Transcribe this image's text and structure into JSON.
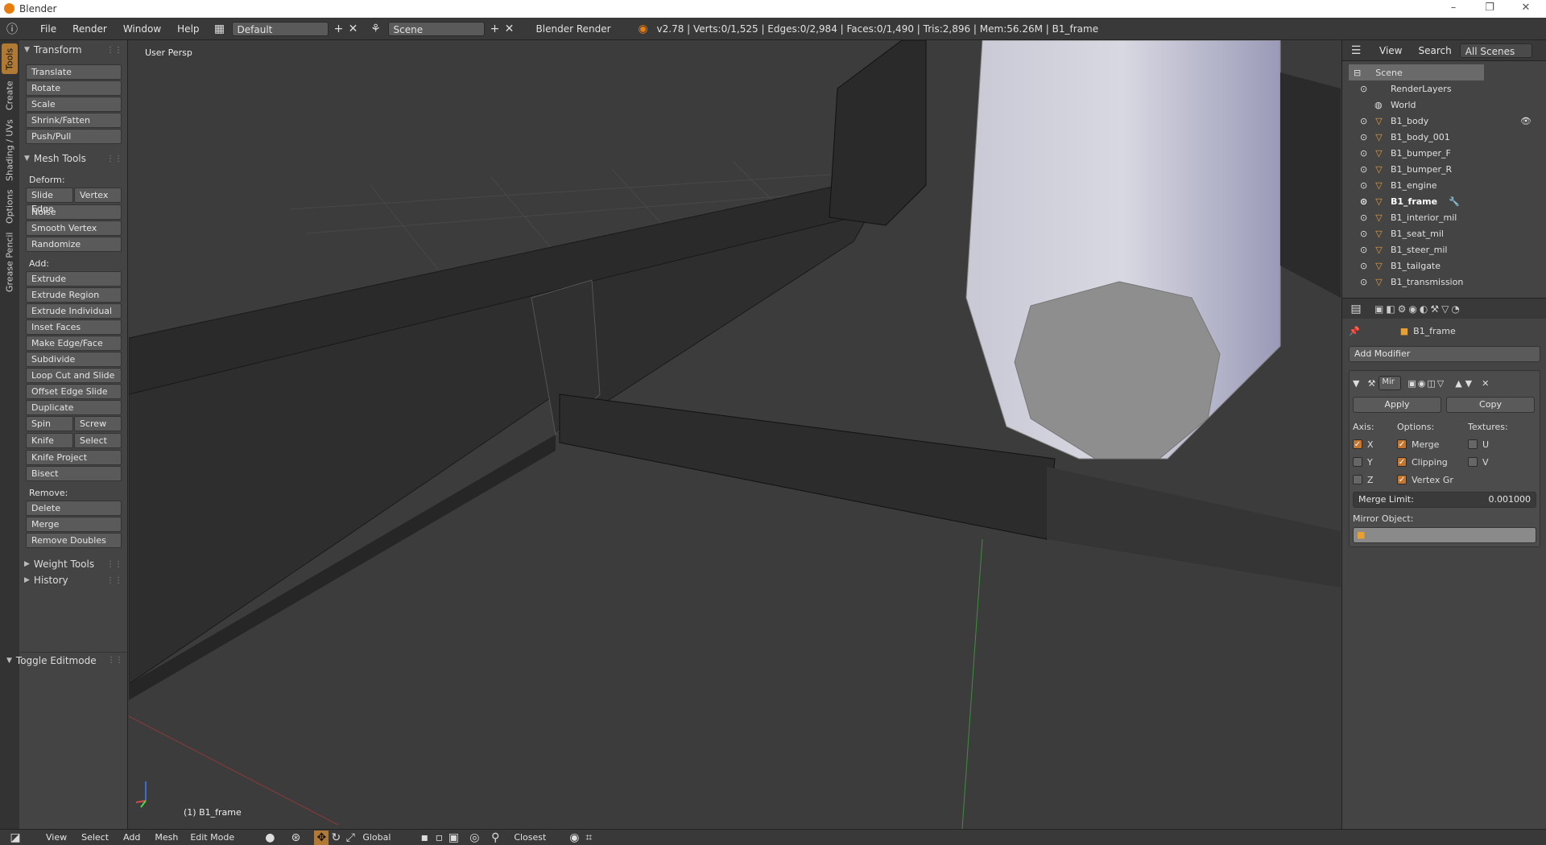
{
  "window": {
    "title": "Blender"
  },
  "infobar": {
    "menus": [
      "File",
      "Render",
      "Window",
      "Help"
    ],
    "layout": "Default",
    "scene": "Scene",
    "engine": "Blender Render",
    "stats": "v2.78 | Verts:0/1,525 | Edges:0/2,984 | Faces:0/1,490 | Tris:2,896 | Mem:56.26M | B1_frame"
  },
  "lefttabs": [
    "Tools",
    "Create",
    "Shading / UVs",
    "Options",
    "Grease Pencil"
  ],
  "toolshelf": {
    "transform": {
      "title": "Transform",
      "buttons": [
        "Translate",
        "Rotate",
        "Scale",
        "Shrink/Fatten",
        "Push/Pull"
      ]
    },
    "meshtools": {
      "title": "Mesh Tools",
      "deform_label": "Deform:",
      "slide_edge": "Slide Edge",
      "vertex": "Vertex",
      "noise": "Noise",
      "smooth_vertex": "Smooth Vertex",
      "randomize": "Randomize",
      "add_label": "Add:",
      "extrude": "Extrude",
      "extrude_region": "Extrude Region",
      "extrude_individual": "Extrude Individual",
      "inset_faces": "Inset Faces",
      "make_edge_face": "Make Edge/Face",
      "subdivide": "Subdivide",
      "loop_cut": "Loop Cut and Slide",
      "offset_edge": "Offset Edge Slide",
      "duplicate": "Duplicate",
      "spin": "Spin",
      "screw": "Screw",
      "knife": "Knife",
      "select": "Select",
      "knife_project": "Knife Project",
      "bisect": "Bisect",
      "remove_label": "Remove:",
      "delete": "Delete",
      "merge": "Merge",
      "remove_doubles": "Remove Doubles"
    },
    "weight_tools": "Weight Tools",
    "history": "History",
    "toggle_editmode": "Toggle Editmode"
  },
  "viewport": {
    "label": "User Persp",
    "object_label": "(1) B1_frame"
  },
  "outliner": {
    "view": "View",
    "search": "Search",
    "filter": "All Scenes",
    "scene": "Scene",
    "renderlayers": "RenderLayers",
    "world": "World",
    "objects": [
      "B1_body",
      "B1_body_001",
      "B1_bumper_F",
      "B1_bumper_R",
      "B1_engine",
      "B1_frame",
      "B1_interior_mil",
      "B1_seat_mil",
      "B1_steer_mil",
      "B1_tailgate",
      "B1_transmission"
    ]
  },
  "properties": {
    "object": "B1_frame",
    "add_modifier": "Add Modifier",
    "modifier_name": "Mir",
    "apply": "Apply",
    "copy": "Copy",
    "axis_label": "Axis:",
    "options_label": "Options:",
    "textures_label": "Textures:",
    "x": "X",
    "y": "Y",
    "z": "Z",
    "merge": "Merge",
    "clipping": "Clipping",
    "vertex_gr": "Vertex Gr",
    "u": "U",
    "v": "V",
    "merge_limit_label": "Merge Limit:",
    "merge_limit_value": "0.001000",
    "mirror_object_label": "Mirror Object:"
  },
  "bottombar": {
    "menus": [
      "View",
      "Select",
      "Add",
      "Mesh"
    ],
    "mode": "Edit Mode",
    "orientation": "Global",
    "snap": "Closest"
  },
  "colors": {
    "accent": "#c5762e",
    "bg": "#3c3c3c",
    "panel": "#444444"
  }
}
